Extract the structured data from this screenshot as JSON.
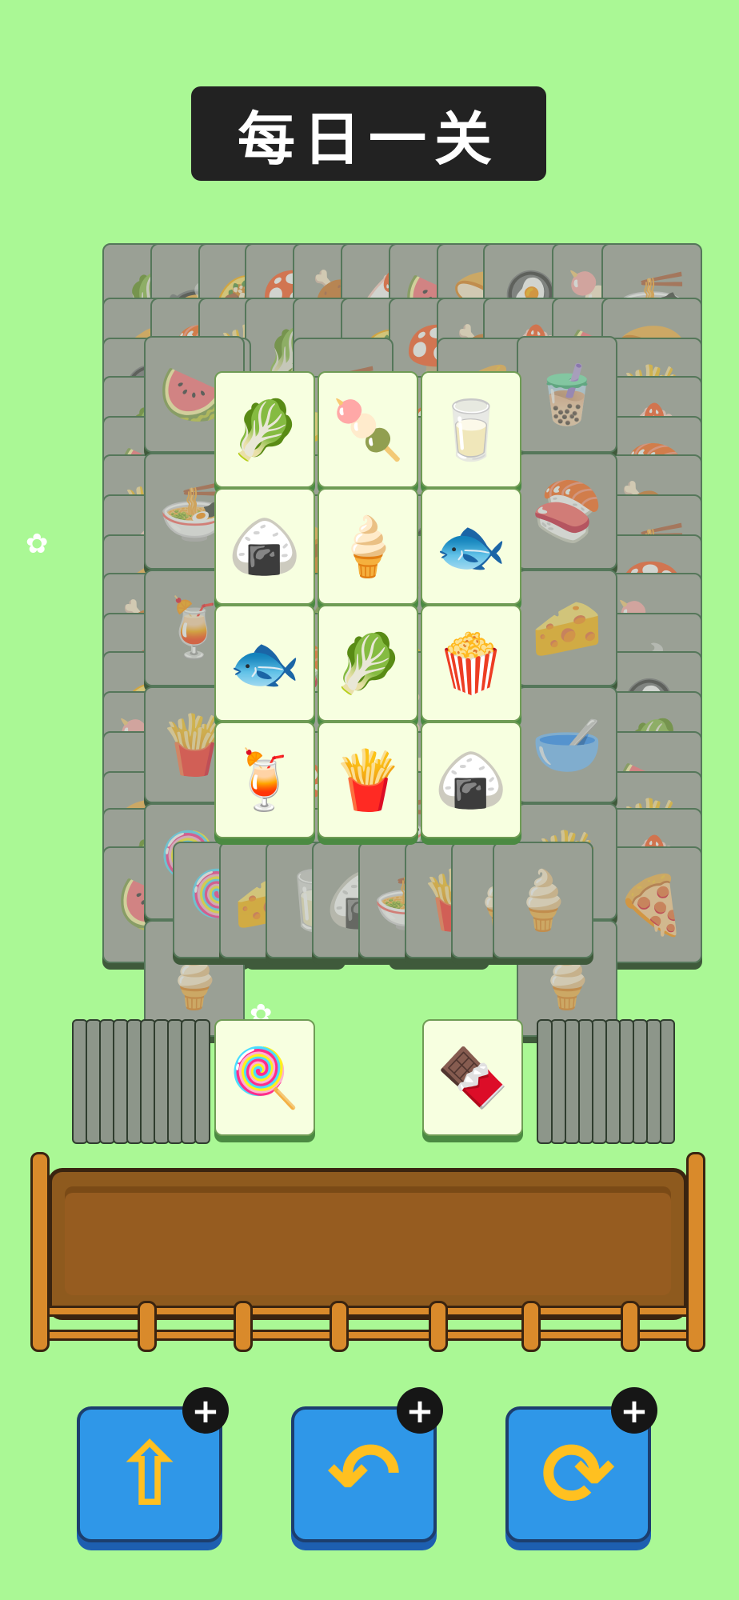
{
  "title": "每日一关",
  "colors": {
    "background": "#aaf895",
    "banner": "#222222",
    "tool_button": "#2f97e8",
    "tray": "#8e5a1e"
  },
  "back_tiles": [
    {
      "icon": "lettuce-icon",
      "g": "🥬"
    },
    {
      "icon": "bowl-icon",
      "g": "🍲"
    },
    {
      "icon": "taco-icon",
      "g": "🌮"
    },
    {
      "icon": "mushroom-icon",
      "g": "🍄"
    },
    {
      "icon": "meat-icon",
      "g": "🍖"
    },
    {
      "icon": "cake-icon",
      "g": "🍰"
    },
    {
      "icon": "melon-icon",
      "g": "🍉"
    },
    {
      "icon": "bread-icon",
      "g": "🍞"
    },
    {
      "icon": "egg-icon",
      "g": "🍳"
    },
    {
      "icon": "popsicle-icon",
      "g": "🍡"
    },
    {
      "icon": "bowl-icon",
      "g": "🍜"
    },
    {
      "icon": "pizza-icon",
      "g": "🍕"
    },
    {
      "icon": "sushi-icon",
      "g": "🍣"
    },
    {
      "icon": "fries-icon",
      "g": "🍟"
    }
  ],
  "side_tiles_left": [
    {
      "icon": "watermelon-icon",
      "g": "🍉"
    },
    {
      "icon": "noodles-cup-icon",
      "g": "🍜"
    },
    {
      "icon": "juice-icon",
      "g": "🍹"
    },
    {
      "icon": "fries-icon",
      "g": "🍟"
    },
    {
      "icon": "lollipop-icon",
      "g": "🍭"
    },
    {
      "icon": "popsicle-icon",
      "g": "🍦"
    }
  ],
  "side_tiles_right": [
    {
      "icon": "bubble-tea-icon",
      "g": "🧋"
    },
    {
      "icon": "sushi-roll-icon",
      "g": "🍣"
    },
    {
      "icon": "cheese-icon",
      "g": "🧀"
    },
    {
      "icon": "soup-bowl-icon",
      "g": "🥣"
    },
    {
      "icon": "fries-icon",
      "g": "🍟"
    },
    {
      "icon": "popsicle-icon",
      "g": "🍦"
    }
  ],
  "bottom_row": [
    {
      "icon": "lollipop-icon",
      "g": "🍭"
    },
    {
      "icon": "cheese-icon",
      "g": "🧀"
    },
    {
      "icon": "milk-icon",
      "g": "🥛"
    },
    {
      "icon": "onigiri-icon",
      "g": "🍙"
    },
    {
      "icon": "noodles-cup-icon",
      "g": "🍜"
    },
    {
      "icon": "fries-icon",
      "g": "🍟"
    },
    {
      "icon": "ice-cream-icon",
      "g": "🍦"
    }
  ],
  "front_tiles": [
    {
      "icon": "lettuce-icon",
      "g": "🥬"
    },
    {
      "icon": "egg-popsicle-icon",
      "g": "🍡"
    },
    {
      "icon": "milk-carton-icon",
      "g": "🥛"
    },
    {
      "icon": "onigiri-icon",
      "g": "🍙"
    },
    {
      "icon": "ice-cream-icon",
      "g": "🍦"
    },
    {
      "icon": "fish-icon",
      "g": "🐟"
    },
    {
      "icon": "fish-icon",
      "g": "🐟"
    },
    {
      "icon": "lettuce-icon",
      "g": "🥬"
    },
    {
      "icon": "popcorn-icon",
      "g": "🍿"
    },
    {
      "icon": "juice-icon",
      "g": "🍹"
    },
    {
      "icon": "fries-icon",
      "g": "🍟"
    },
    {
      "icon": "onigiri-icon",
      "g": "🍙"
    }
  ],
  "left_stack_top": {
    "icon": "lollipop-icon",
    "g": "🍭"
  },
  "right_stack_top": {
    "icon": "ice-cream-bar-icon",
    "g": "🍫"
  },
  "tools": [
    {
      "name": "move-out-button",
      "icon": "upload-icon",
      "g": "⇧"
    },
    {
      "name": "undo-button",
      "icon": "undo-icon",
      "g": "↶"
    },
    {
      "name": "shuffle-button",
      "icon": "shuffle-icon",
      "g": "⟳"
    }
  ],
  "plus_label": "+"
}
